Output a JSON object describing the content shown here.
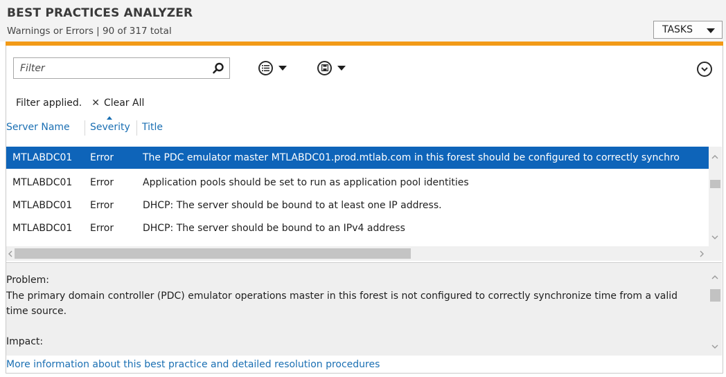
{
  "header": {
    "title": "BEST PRACTICES ANALYZER",
    "subtitle": "Warnings or Errors | 90 of 317 total",
    "tasks_label": "TASKS"
  },
  "toolbar": {
    "filter_placeholder": "Filter",
    "filter_value": "",
    "search_icon": "search-icon",
    "view_icon": "list-options-icon",
    "save_icon": "save-query-icon",
    "expand_icon": "expand-chevron-icon"
  },
  "filter_status": {
    "label": "Filter applied.",
    "clear_label": "Clear All"
  },
  "columns": [
    "Server Name",
    "Severity",
    "Title"
  ],
  "sorted_column": "Severity",
  "rows": [
    {
      "server": "MTLABDC01",
      "severity": "Error",
      "title": "The PDC emulator master MTLABDC01.prod.mtlab.com in this forest should be configured to correctly synchro",
      "selected": true
    },
    {
      "server": "MTLABDC01",
      "severity": "Error",
      "title": "Application pools should be set to run as application pool identities",
      "selected": false
    },
    {
      "server": "MTLABDC01",
      "severity": "Error",
      "title": "DHCP: The server should be bound to at least one IP address.",
      "selected": false
    },
    {
      "server": "MTLABDC01",
      "severity": "Error",
      "title": "DHCP: The server should be bound to an IPv4 address",
      "selected": false
    }
  ],
  "detail": {
    "problem_label": "Problem:",
    "problem_text": "The primary domain controller (PDC) emulator operations master in this forest is not configured to correctly synchronize time from a valid time source.",
    "impact_label": "Impact:"
  },
  "more_info_link": "More information about this best practice and detailed resolution procedures",
  "colors": {
    "accent_orange": "#f29a17",
    "selection_blue": "#0e64b9",
    "link_blue": "#1a6fb3"
  }
}
